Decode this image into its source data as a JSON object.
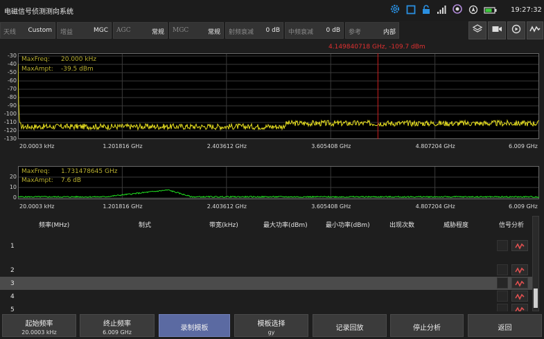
{
  "app": {
    "title": "电磁信号侦测测向系统",
    "time": "19:27:32"
  },
  "colors": {
    "trace_top": "#e8e020",
    "trace_bottom": "#20e020",
    "marker": "#d02020",
    "max_text": "#b9b030",
    "active_button": "#5b6aa2",
    "accent_icon": "#2a8fe0"
  },
  "status_icons": [
    "gear-icon",
    "square-icon",
    "lock-icon",
    "signal-bars-icon",
    "user-circle-icon",
    "nav-icon",
    "battery-icon"
  ],
  "params": [
    {
      "label": "天线",
      "value": "Custom"
    },
    {
      "label": "增益",
      "value": "MGC"
    },
    {
      "label": "AGC",
      "value": "常规"
    },
    {
      "label": "MGC",
      "value": "常规"
    },
    {
      "label": "射频衰减",
      "value": "0 dB"
    },
    {
      "label": "中频衰减",
      "value": "0 dB"
    },
    {
      "label": "参考",
      "value": "内部"
    }
  ],
  "toolbar_icons": [
    "layers-icon",
    "video-camera-icon",
    "replay-icon",
    "signal-wave-icon"
  ],
  "marker": {
    "readout": "4.149840718 GHz, -109.7 dBm",
    "freq_ghz": 4.149840718
  },
  "chart_data": [
    {
      "type": "line",
      "title": "",
      "xlabel": "",
      "ylabel": "",
      "x_ticks": [
        "20.0003 kHz",
        "1.201816 GHz",
        "2.403612 GHz",
        "3.605408 GHz",
        "4.807204 GHz",
        "6.009 GHz"
      ],
      "y_ticks": [
        "-30",
        "-40",
        "-50",
        "-60",
        "-70",
        "-80",
        "-90",
        "-100",
        "-110",
        "-120",
        "-130"
      ],
      "ylim": [
        -130,
        -30
      ],
      "xlim_ghz": [
        2.00003e-05,
        6.009
      ],
      "annotations": [
        "MaxFreq:",
        "20.000 kHz",
        "MaxAmpt:",
        "-39.5 dBm"
      ],
      "series": [
        {
          "x_ghz": [
            2e-05,
            0.01,
            0.02,
            0.05,
            1.0,
            2.0,
            3.0,
            3.06,
            3.1,
            4.0,
            5.0,
            6.009
          ],
          "y_dbm": [
            -39.5,
            -100,
            -113,
            -115,
            -115,
            -115,
            -115,
            -115,
            -111,
            -111,
            -111,
            -111
          ]
        }
      ],
      "grid": true
    },
    {
      "type": "line",
      "title": "",
      "xlabel": "",
      "ylabel": "",
      "x_ticks": [
        "20.0003 kHz",
        "1.201816 GHz",
        "2.403612 GHz",
        "3.605408 GHz",
        "4.807204 GHz",
        "6.009 GHz"
      ],
      "y_ticks": [
        "20",
        "10",
        "0"
      ],
      "ylim": [
        0,
        28
      ],
      "xlim_ghz": [
        2.00003e-05,
        6.009
      ],
      "annotations": [
        "MaxFreq:",
        "1.731478645 GHz",
        "MaxAmpt:",
        "7.6 dB"
      ],
      "series": [
        {
          "x_ghz": [
            2e-05,
            1.0,
            1.731478645,
            2.0,
            3.0,
            4.0,
            5.0,
            6.009
          ],
          "y_db": [
            1,
            1,
            7.6,
            1,
            1,
            1,
            1,
            1
          ]
        }
      ],
      "grid": true
    }
  ],
  "table": {
    "headers": [
      "频率(MHz)",
      "制式",
      "带宽(kHz)",
      "最大功率(dBm)",
      "最小功率(dBm)",
      "出现次数",
      "威胁程度",
      "信号分析"
    ],
    "rows": [
      "1",
      "2",
      "3",
      "4",
      "5"
    ],
    "selected_row": 3
  },
  "bottom_buttons": [
    {
      "label": "起始频率",
      "sub": "20.0003 kHz"
    },
    {
      "label": "终止频率",
      "sub": "6.009 GHz"
    },
    {
      "label": "录制模板",
      "sub": ""
    },
    {
      "label": "模板选择",
      "sub": "gy"
    },
    {
      "label": "记录回放",
      "sub": ""
    },
    {
      "label": "停止分析",
      "sub": ""
    },
    {
      "label": "返回",
      "sub": ""
    }
  ]
}
